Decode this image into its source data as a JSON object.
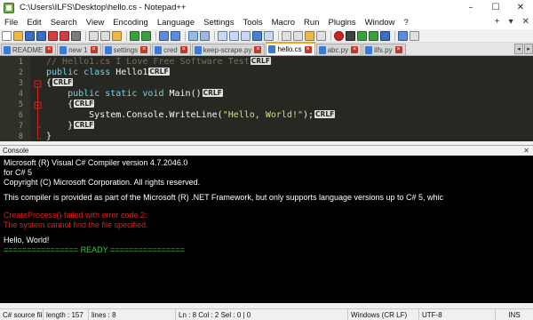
{
  "window": {
    "title": "C:\\Users\\ILFS\\Desktop\\hello.cs - Notepad++",
    "minimize": "–",
    "maximize": "☐",
    "close": "✕"
  },
  "menu": {
    "items": [
      "File",
      "Edit",
      "Search",
      "View",
      "Encoding",
      "Language",
      "Settings",
      "Tools",
      "Macro",
      "Run",
      "Plugins",
      "Window",
      "?"
    ],
    "right_glyphs": [
      "+",
      "▾",
      "✕"
    ]
  },
  "tabs": [
    {
      "label": "README",
      "icon_color": "#3a7bd5",
      "active": false
    },
    {
      "label": "new 1",
      "icon_color": "#3a7bd5",
      "active": false
    },
    {
      "label": "settings",
      "icon_color": "#3a7bd5",
      "active": false
    },
    {
      "label": "cred",
      "icon_color": "#3a7bd5",
      "active": false
    },
    {
      "label": "keep-scrape.py",
      "icon_color": "#3a7bd5",
      "active": false
    },
    {
      "label": "hello.cs",
      "icon_color": "#3a7bd5",
      "active": true
    },
    {
      "label": "abc.py",
      "icon_color": "#3a7bd5",
      "active": false
    },
    {
      "label": "ilfs.py",
      "icon_color": "#3a7bd5",
      "active": false
    }
  ],
  "tab_arrows": [
    "◂",
    "▸"
  ],
  "editor": {
    "line_numbers": [
      "1",
      "2",
      "3",
      "4",
      "5",
      "6",
      "7",
      "8"
    ],
    "eol_marker": "CRLF",
    "lines": {
      "l1_comment": "// Hello1.cs I Love Free Software Test",
      "l2_kw": "public class",
      "l2_name": " Hello1",
      "l3_brace": "{",
      "l4_indent": "    ",
      "l4_kw": "public static void",
      "l4_name": " Main()",
      "l5_brace": "    {",
      "l6_code": "        System.Console.WriteLine(",
      "l6_str": "\"Hello, World!\"",
      "l6_end": ");",
      "l7_brace": "    }",
      "l8_brace": "}"
    }
  },
  "console": {
    "header": "Console",
    "close": "✕",
    "lines": [
      {
        "text": "Microsoft (R) Visual C# Compiler version 4.7.2046.0",
        "color": "white"
      },
      {
        "text": "for C# 5",
        "color": "white"
      },
      {
        "text": "Copyright (C) Microsoft Corporation. All rights reserved.",
        "color": "white"
      },
      {
        "text": "",
        "color": "white"
      },
      {
        "text": "This compiler is provided as part of the Microsoft (R) .NET Framework, but only supports language versions up to C# 5, whic",
        "color": "white"
      },
      {
        "text": "",
        "color": "white"
      },
      {
        "text": "CreateProcess() failed with error code 2:",
        "color": "red"
      },
      {
        "text": "The system cannot find the file specified.",
        "color": "red"
      },
      {
        "text": "",
        "color": "white"
      },
      {
        "text": "Hello, World!",
        "color": "white"
      },
      {
        "text": "================ READY ================",
        "color": "green"
      }
    ]
  },
  "status": {
    "file_type": "C# source file",
    "length": "length : 157",
    "lines": "lines : 8",
    "position": "Ln : 8   Col : 2   Sel : 0 | 0",
    "eol": "Windows (CR LF)",
    "encoding": "UTF-8",
    "mode": "INS"
  },
  "colors": {
    "editor_bg": "#272822",
    "keyword": "#66d9ef",
    "comment": "#75715e",
    "string": "#e6db74",
    "console_bg": "#000000",
    "console_error": "#e02020",
    "console_ready": "#3cc83c",
    "active_tab_accent": "#f4a020"
  }
}
